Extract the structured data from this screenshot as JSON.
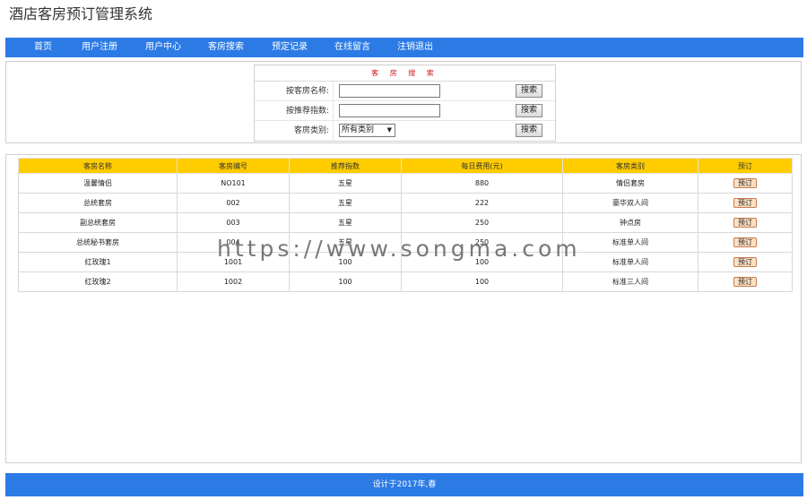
{
  "header": {
    "title": "酒店客房预订管理系统"
  },
  "nav": {
    "items": [
      "首页",
      "用户注册",
      "用户中心",
      "客房搜索",
      "预定记录",
      "在线留言",
      "注销退出"
    ]
  },
  "search": {
    "title": "客 房 搜 索",
    "rows": [
      {
        "label": "按客房名称:",
        "value": "",
        "button": "搜索"
      },
      {
        "label": "按推荐指数:",
        "value": "",
        "button": "搜索"
      },
      {
        "label": "客房类别:",
        "selected": "所有类别",
        "button": "搜索"
      }
    ]
  },
  "rooms": {
    "columns": [
      "客房名称",
      "客房编号",
      "推荐指数",
      "每日费用(元)",
      "客房类别",
      "预订"
    ],
    "rows": [
      [
        "温馨情侣",
        "NO101",
        "五星",
        "880",
        "情侣套房"
      ],
      [
        "总统套房",
        "002",
        "五星",
        "222",
        "豪华双人间"
      ],
      [
        "副总统套房",
        "003",
        "五星",
        "250",
        "钟点房"
      ],
      [
        "总统秘书套房",
        "004",
        "五星",
        "250",
        "标准单人间"
      ],
      [
        "红玫瑰1",
        "1001",
        "100",
        "100",
        "标准单人间"
      ],
      [
        "红玫瑰2",
        "1002",
        "100",
        "100",
        "标准三人间"
      ]
    ],
    "book_label": "预订"
  },
  "watermark": "https://www.songma.com",
  "footer": {
    "text": "设计于2017年,春"
  },
  "colors": {
    "nav": "#2c7be5",
    "table_header": "#ffcc00",
    "search_title": "#d21a1a"
  }
}
